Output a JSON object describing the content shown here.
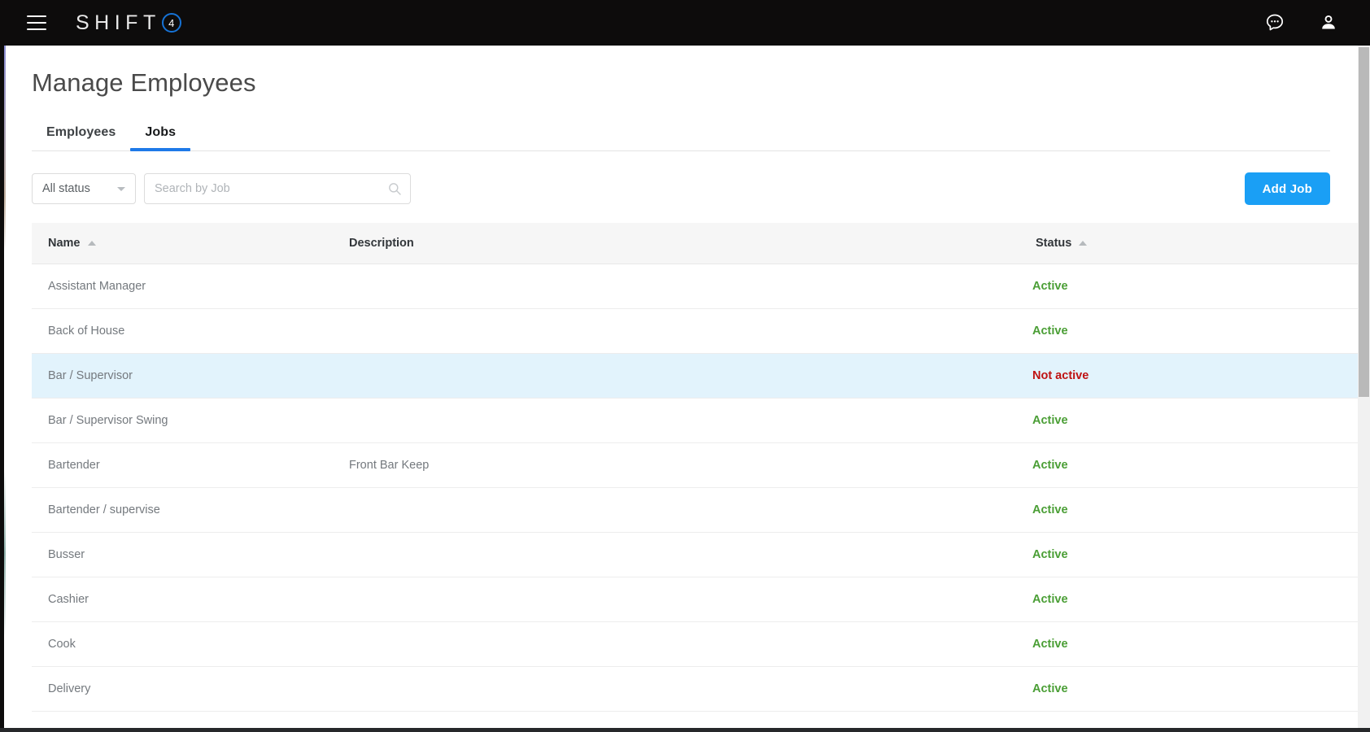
{
  "appbar": {
    "menu_icon": "hamburger-icon",
    "brand_word": "SHIFT",
    "brand_badge": "4",
    "chat_icon": "chat-bubble-icon",
    "account_icon": "user-account-icon"
  },
  "page": {
    "title": "Manage Employees"
  },
  "tabs": [
    {
      "label": "Employees",
      "active": false
    },
    {
      "label": "Jobs",
      "active": true
    }
  ],
  "filters": {
    "status_select_value": "All status",
    "search_value": "",
    "search_placeholder": "Search by Job",
    "search_icon": "search-icon",
    "add_button_label": "Add Job"
  },
  "table": {
    "columns": [
      {
        "label": "Name",
        "sort": "asc"
      },
      {
        "label": "Description",
        "sort": "none"
      },
      {
        "label": "Status",
        "sort": "asc"
      }
    ],
    "rows": [
      {
        "name": "Assistant Manager",
        "description": "",
        "status": "Active",
        "state": "active",
        "highlight": false
      },
      {
        "name": "Back of House",
        "description": "",
        "status": "Active",
        "state": "active",
        "highlight": false
      },
      {
        "name": "Bar / Supervisor",
        "description": "",
        "status": "Not active",
        "state": "inactive",
        "highlight": true
      },
      {
        "name": "Bar / Supervisor Swing",
        "description": "",
        "status": "Active",
        "state": "active",
        "highlight": false
      },
      {
        "name": "Bartender",
        "description": "Front Bar Keep",
        "status": "Active",
        "state": "active",
        "highlight": false
      },
      {
        "name": "Bartender / supervise",
        "description": "",
        "status": "Active",
        "state": "active",
        "highlight": false
      },
      {
        "name": "Busser",
        "description": "",
        "status": "Active",
        "state": "active",
        "highlight": false
      },
      {
        "name": "Cashier",
        "description": "",
        "status": "Active",
        "state": "active",
        "highlight": false
      },
      {
        "name": "Cook",
        "description": "",
        "status": "Active",
        "state": "active",
        "highlight": false
      },
      {
        "name": "Delivery",
        "description": "",
        "status": "Active",
        "state": "active",
        "highlight": false
      }
    ]
  },
  "colors": {
    "accent_blue": "#1a9ff5",
    "tab_underline": "#1e7ae8",
    "status_active": "#4a9e35",
    "status_inactive": "#bf1212",
    "row_highlight": "#e2f3fc",
    "appbar_bg": "#0d0c0c"
  }
}
